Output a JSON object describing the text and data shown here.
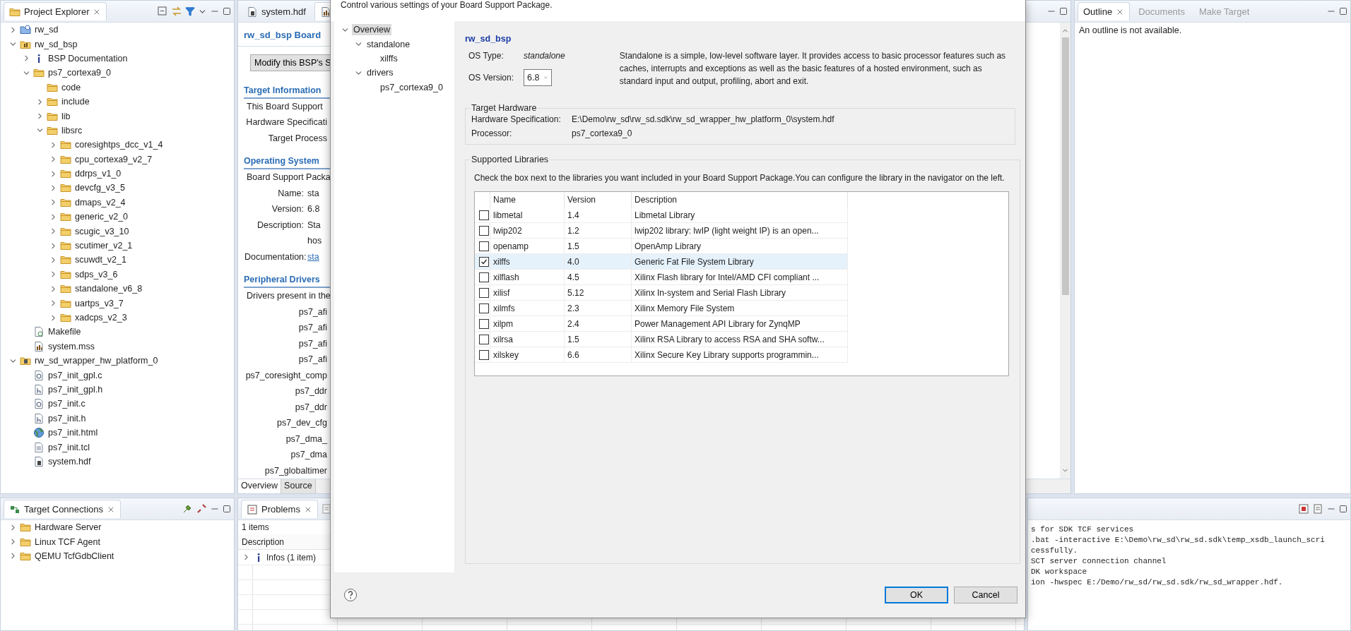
{
  "project_explorer": {
    "title": "Project Explorer",
    "tree": [
      {
        "label": "rw_sd",
        "kind": "c-project",
        "expanded": false
      },
      {
        "label": "rw_sd_bsp",
        "kind": "bsp-project",
        "expanded": true,
        "children": [
          {
            "label": "BSP Documentation",
            "kind": "info",
            "expanded": false
          },
          {
            "label": "ps7_cortexa9_0",
            "kind": "folder",
            "expanded": true,
            "children": [
              {
                "label": "code",
                "kind": "folder"
              },
              {
                "label": "include",
                "kind": "folder",
                "expanded": false
              },
              {
                "label": "lib",
                "kind": "folder",
                "expanded": false
              },
              {
                "label": "libsrc",
                "kind": "folder",
                "expanded": true,
                "children": [
                  {
                    "label": "coresightps_dcc_v1_4",
                    "kind": "folder",
                    "expanded": false
                  },
                  {
                    "label": "cpu_cortexa9_v2_7",
                    "kind": "folder",
                    "expanded": false
                  },
                  {
                    "label": "ddrps_v1_0",
                    "kind": "folder",
                    "expanded": false
                  },
                  {
                    "label": "devcfg_v3_5",
                    "kind": "folder",
                    "expanded": false
                  },
                  {
                    "label": "dmaps_v2_4",
                    "kind": "folder",
                    "expanded": false
                  },
                  {
                    "label": "generic_v2_0",
                    "kind": "folder",
                    "expanded": false
                  },
                  {
                    "label": "scugic_v3_10",
                    "kind": "folder",
                    "expanded": false
                  },
                  {
                    "label": "scutimer_v2_1",
                    "kind": "folder",
                    "expanded": false
                  },
                  {
                    "label": "scuwdt_v2_1",
                    "kind": "folder",
                    "expanded": false
                  },
                  {
                    "label": "sdps_v3_6",
                    "kind": "folder",
                    "expanded": false
                  },
                  {
                    "label": "standalone_v6_8",
                    "kind": "folder",
                    "expanded": false
                  },
                  {
                    "label": "uartps_v3_7",
                    "kind": "folder",
                    "expanded": false
                  },
                  {
                    "label": "xadcps_v2_3",
                    "kind": "folder",
                    "expanded": false
                  }
                ]
              }
            ]
          },
          {
            "label": "Makefile",
            "kind": "makefile"
          },
          {
            "label": "system.mss",
            "kind": "mss"
          }
        ]
      },
      {
        "label": "rw_sd_wrapper_hw_platform_0",
        "kind": "hw-platform",
        "expanded": true,
        "children": [
          {
            "label": "ps7_init_gpl.c",
            "kind": "c-file"
          },
          {
            "label": "ps7_init_gpl.h",
            "kind": "h-file"
          },
          {
            "label": "ps7_init.c",
            "kind": "c-file"
          },
          {
            "label": "ps7_init.h",
            "kind": "h-file"
          },
          {
            "label": "ps7_init.html",
            "kind": "html"
          },
          {
            "label": "ps7_init.tcl",
            "kind": "tcl"
          },
          {
            "label": "system.hdf",
            "kind": "hdf"
          }
        ]
      }
    ]
  },
  "editor": {
    "tab": "system.hdf",
    "title": "rw_sd_bsp Board",
    "button": "Modify this BSP's S",
    "sections": [
      {
        "heading": "Target Information",
        "lines": [
          {
            "kind": "text",
            "text": "This Board Support"
          },
          {
            "kind": "label",
            "text": "Hardware Specificati"
          },
          {
            "kind": "label",
            "text": "Target Process"
          }
        ]
      },
      {
        "heading": "Operating System",
        "lines": [
          {
            "kind": "text",
            "text": "Board Support Packa"
          },
          {
            "kind": "field",
            "label": "Name:",
            "value": "sta"
          },
          {
            "kind": "field",
            "label": "Version:",
            "value": "6.8"
          },
          {
            "kind": "field",
            "label": "Description:",
            "value": "Sta"
          },
          {
            "kind": "continuation",
            "text": "hos"
          },
          {
            "kind": "link-field",
            "label": "Documentation:",
            "value": "sta"
          }
        ]
      },
      {
        "heading": "Peripheral Drivers",
        "lines": [
          {
            "kind": "text",
            "text": "Drivers present in the"
          },
          {
            "kind": "driver",
            "text": "ps7_afi"
          },
          {
            "kind": "driver",
            "text": "ps7_afi"
          },
          {
            "kind": "driver",
            "text": "ps7_afi"
          },
          {
            "kind": "driver",
            "text": "ps7_afi"
          },
          {
            "kind": "driver",
            "text": "ps7_coresight_comp"
          },
          {
            "kind": "driver",
            "text": "ps7_ddr"
          },
          {
            "kind": "driver",
            "text": "ps7_ddr"
          },
          {
            "kind": "driver",
            "text": "ps7_dev_cfg"
          },
          {
            "kind": "driver",
            "text": "ps7_dma_"
          },
          {
            "kind": "driver",
            "text": "ps7_dma"
          },
          {
            "kind": "driver",
            "text": "ps7_globaltimer"
          }
        ]
      }
    ],
    "bottom_tabs": [
      {
        "label": "Overview",
        "selected": true
      },
      {
        "label": "Source",
        "selected": false
      }
    ]
  },
  "outline": {
    "tabs": [
      {
        "label": "Outline",
        "selected": true
      },
      {
        "label": "Documents",
        "selected": false
      },
      {
        "label": "Make Target",
        "selected": false
      }
    ],
    "message": "An outline is not available."
  },
  "target_connections": {
    "title": "Target Connections",
    "items": [
      {
        "label": "Hardware Server",
        "expanded": false
      },
      {
        "label": "Linux TCF Agent",
        "expanded": false
      },
      {
        "label": "QEMU TcfGdbClient",
        "expanded": false
      }
    ]
  },
  "problems": {
    "tab": "Problems",
    "count": "1 items",
    "column": "Description",
    "rows": [
      {
        "label": "Infos (1 item)",
        "expanded": false
      }
    ]
  },
  "console": {
    "lines": [
      "s for SDK TCF services",
      ".bat -interactive E:\\Demo\\rw_sd\\rw_sd.sdk\\temp_xsdb_launch_scri",
      "cessfully.",
      "SCT server connection channel",
      "DK workspace",
      "ion -hwspec E:/Demo/rw_sd/rw_sd.sdk/rw_sd_wrapper.hdf."
    ]
  },
  "dialog": {
    "subtitle": "Control various settings of your Board Support Package.",
    "nav": [
      {
        "label": "Overview",
        "selected": true,
        "expanded": true,
        "children": [
          {
            "label": "standalone",
            "selected": false,
            "expanded": true,
            "children": [
              {
                "label": "xilffs",
                "selected": false
              }
            ]
          },
          {
            "label": "drivers",
            "selected": false,
            "expanded": true,
            "children": [
              {
                "label": "ps7_cortexa9_0",
                "selected": false
              }
            ]
          }
        ]
      }
    ],
    "title": "rw_sd_bsp",
    "os_type": {
      "label": "OS Type:",
      "value": "standalone"
    },
    "os_version": {
      "label": "OS Version:",
      "value": "6.8"
    },
    "os_description": "Standalone is a simple, low-level software layer. It provides access to basic processor features such as caches, interrupts and exceptions as well as the basic features of a hosted environment, such as standard input and output, profiling, abort and exit.",
    "target_hardware": {
      "legend": "Target Hardware",
      "fields": [
        {
          "label": "Hardware Specification:",
          "value": "E:\\Demo\\rw_sd\\rw_sd.sdk\\rw_sd_wrapper_hw_platform_0\\system.hdf"
        },
        {
          "label": "Processor:",
          "value": "ps7_cortexa9_0"
        }
      ]
    },
    "libraries": {
      "legend": "Supported Libraries",
      "hint": "Check the box next to the libraries you want included in your Board Support Package.You can configure the library in the navigator on the left.",
      "columns": [
        "Name",
        "Version",
        "Description"
      ],
      "rows": [
        {
          "checked": false,
          "selected": false,
          "name": "libmetal",
          "version": "1.4",
          "description": "Libmetal Library"
        },
        {
          "checked": false,
          "selected": false,
          "name": "lwip202",
          "version": "1.2",
          "description": "lwip202 library: lwIP (light weight IP) is an open..."
        },
        {
          "checked": false,
          "selected": false,
          "name": "openamp",
          "version": "1.5",
          "description": "OpenAmp Library"
        },
        {
          "checked": true,
          "selected": true,
          "name": "xilffs",
          "version": "4.0",
          "description": "Generic Fat File System Library"
        },
        {
          "checked": false,
          "selected": false,
          "name": "xilflash",
          "version": "4.5",
          "description": "Xilinx Flash library for Intel/AMD CFI compliant ..."
        },
        {
          "checked": false,
          "selected": false,
          "name": "xilisf",
          "version": "5.12",
          "description": "Xilinx In-system and Serial Flash Library"
        },
        {
          "checked": false,
          "selected": false,
          "name": "xilmfs",
          "version": "2.3",
          "description": "Xilinx Memory File System"
        },
        {
          "checked": false,
          "selected": false,
          "name": "xilpm",
          "version": "2.4",
          "description": "Power Management API Library for ZynqMP"
        },
        {
          "checked": false,
          "selected": false,
          "name": "xilrsa",
          "version": "1.5",
          "description": "Xilinx RSA Library to access RSA and SHA softw..."
        },
        {
          "checked": false,
          "selected": false,
          "name": "xilskey",
          "version": "6.6",
          "description": "Xilinx Secure Key Library supports programmin..."
        }
      ]
    },
    "buttons": [
      {
        "label": "OK",
        "default": true
      },
      {
        "label": "Cancel",
        "default": false
      }
    ]
  }
}
